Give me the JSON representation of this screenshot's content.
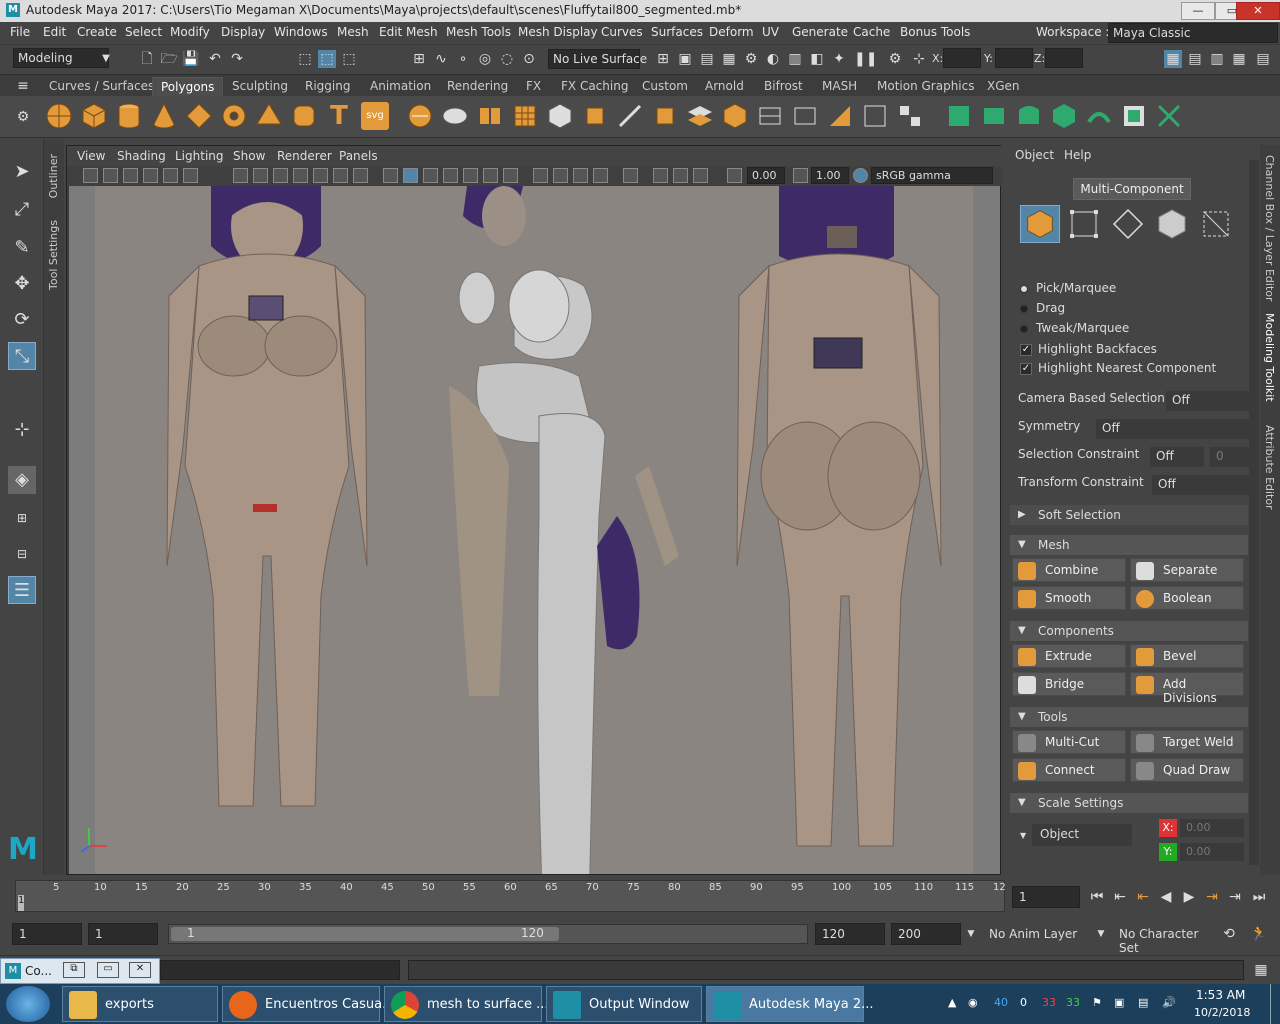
{
  "window": {
    "title": "Autodesk Maya 2017: C:\\Users\\Tio Megaman X\\Documents\\Maya\\projects\\default\\scenes\\Fluffytail800_segmented.mb*",
    "logo": "M"
  },
  "menubar": [
    "File",
    "Edit",
    "Create",
    "Select",
    "Modify",
    "Display",
    "Windows",
    "Mesh",
    "Edit Mesh",
    "Mesh Tools",
    "Mesh Display",
    "Curves",
    "Surfaces",
    "Deform",
    "UV",
    "Generate",
    "Cache",
    "Bonus Tools"
  ],
  "workspace": {
    "label": "Workspace :",
    "value": "Maya Classic"
  },
  "statusline": {
    "menuset": "Modeling",
    "live_surface": "No Live Surface",
    "x_label": "X:",
    "y_label": "Y:",
    "z_label": "Z:"
  },
  "shelf_tabs": [
    "Curves / Surfaces",
    "Polygons",
    "Sculpting",
    "Rigging",
    "Animation",
    "Rendering",
    "FX",
    "FX Caching",
    "Custom",
    "Arnold",
    "Bifrost",
    "MASH",
    "Motion Graphics",
    "XGen"
  ],
  "shelf_active": "Polygons",
  "shelf_text_icons": {
    "text_tool": "T",
    "svg_tool": "svg"
  },
  "side_tabs": [
    "Outliner",
    "Tool Settings"
  ],
  "viewport": {
    "menus": [
      "View",
      "Shading",
      "Lighting",
      "Show",
      "Renderer",
      "Panels"
    ],
    "exposure": "0.00",
    "gamma": "1.00",
    "colorspace": "sRGB gamma"
  },
  "modeling_toolkit": {
    "menus": [
      "Object",
      "Help"
    ],
    "mode_label": "Multi-Component",
    "selection_modes": [
      "object-mode",
      "vertex-mode",
      "edge-mode",
      "face-mode",
      "uv-mode"
    ],
    "pick_options": [
      {
        "label": "Pick/Marquee",
        "on": true
      },
      {
        "label": "Drag",
        "on": false
      },
      {
        "label": "Tweak/Marquee",
        "on": false
      }
    ],
    "checks": [
      {
        "label": "Highlight Backfaces",
        "checked": true
      },
      {
        "label": "Highlight Nearest Component",
        "checked": true
      }
    ],
    "props": [
      {
        "label": "Camera Based Selection",
        "value": "Off"
      },
      {
        "label": "Symmetry",
        "value": "Off"
      },
      {
        "label": "Selection Constraint",
        "value": "Off",
        "extra": "0"
      },
      {
        "label": "Transform Constraint",
        "value": "Off"
      }
    ],
    "soft_selection": "Soft Selection",
    "sections": {
      "mesh": {
        "title": "Mesh",
        "buttons": [
          "Combine",
          "Separate",
          "Smooth",
          "Boolean"
        ]
      },
      "components": {
        "title": "Components",
        "buttons": [
          "Extrude",
          "Bevel",
          "Bridge",
          "Add Divisions"
        ]
      },
      "tools": {
        "title": "Tools",
        "buttons": [
          "Multi-Cut",
          "Target Weld",
          "Connect",
          "Quad Draw"
        ]
      }
    },
    "scale_settings": {
      "title": "Scale Settings",
      "mode": "Object",
      "x": "0.00",
      "y": "0.00",
      "x_label": "X:",
      "y_label": "Y:"
    }
  },
  "right_vtabs": [
    "Channel Box / Layer Editor",
    "Modeling Toolkit",
    "Attribute Editor"
  ],
  "timeline": {
    "ticks": [
      "5",
      "10",
      "15",
      "20",
      "25",
      "30",
      "35",
      "40",
      "45",
      "50",
      "55",
      "60",
      "65",
      "70",
      "75",
      "80",
      "85",
      "90",
      "95",
      "100",
      "105",
      "110",
      "115",
      "12"
    ],
    "current_marker": "1",
    "current_frame": "1"
  },
  "range": {
    "start": "1",
    "playback_start": "1",
    "slider_start": "1",
    "slider_end": "120",
    "playback_end": "120",
    "end": "200",
    "anim_layer": "No Anim Layer",
    "char_set": "No Character Set"
  },
  "cmdline": {
    "tab": "Co..."
  },
  "taskbar": {
    "items": [
      {
        "label": "exports",
        "color": "#e8b84a"
      },
      {
        "label": "Encuentros Casua...",
        "color": "#e8661a"
      },
      {
        "label": "mesh to surface ...",
        "color": "#3c9a4a"
      },
      {
        "label": "Output Window",
        "color": "#1e8fa5"
      },
      {
        "label": "Autodesk Maya 2...",
        "color": "#1e8fa5"
      }
    ],
    "tray": {
      "n1": "40",
      "n2": "0",
      "n3": "33",
      "n4": "33"
    },
    "time": "1:53 AM",
    "date": "10/2/2018"
  }
}
